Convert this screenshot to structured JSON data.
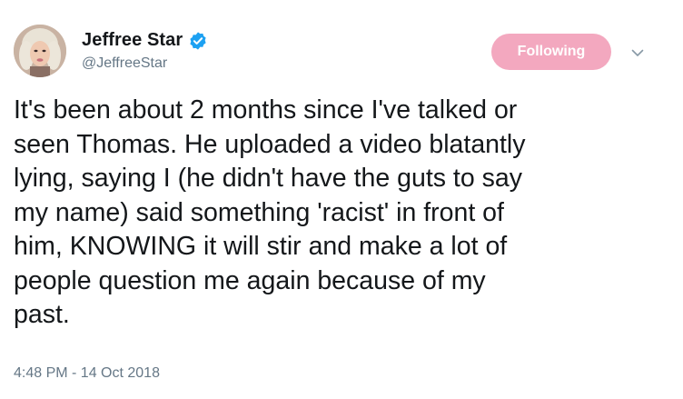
{
  "author": {
    "display_name": "Jeffree Star",
    "handle": "@JeffreeStar",
    "verified": true,
    "avatar_icon": "profile-photo"
  },
  "follow_button": {
    "label": "Following",
    "color": "#f3a8bf"
  },
  "menu_icon": "chevron-down-icon",
  "tweet": {
    "lines": [
      "It's been about 2 months since I've talked or",
      "seen Thomas. He uploaded a video blatantly",
      "lying, saying I (he didn't have the guts to say",
      "my name) said something 'racist' in front of",
      "him, KNOWING it will stir and make a lot of",
      "people question me again because of my",
      "past."
    ]
  },
  "timestamp": "4:48 PM - 14 Oct 2018",
  "colors": {
    "verified_blue": "#1da1f2",
    "secondary_text": "#657786",
    "primary_text": "#14171a"
  }
}
